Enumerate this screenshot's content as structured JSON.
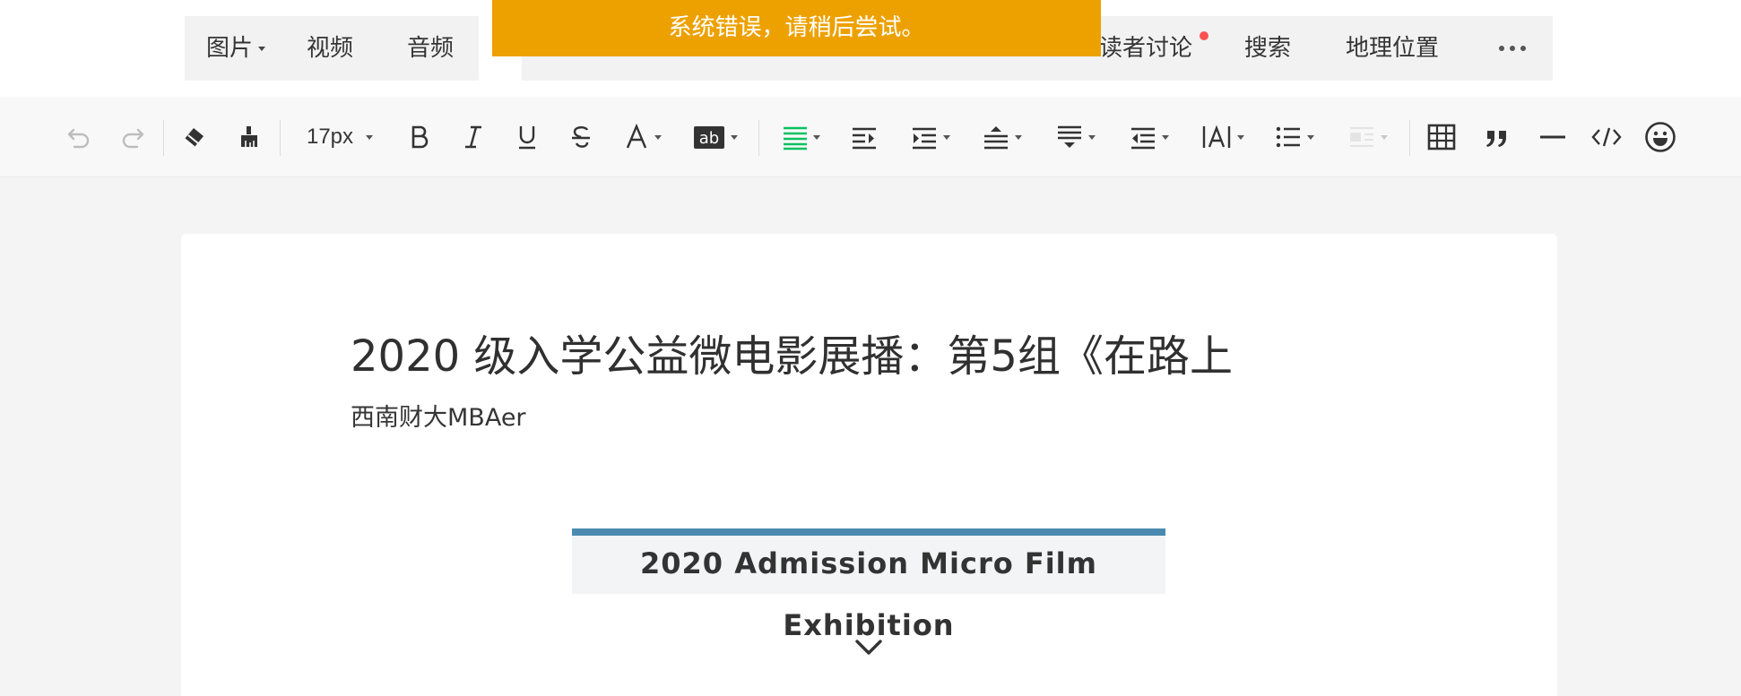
{
  "toast": {
    "message": "系统错误，请稍后尝试。"
  },
  "insert_bar": {
    "group_a": [
      {
        "label": "图片",
        "has_dropdown": true
      },
      {
        "label": "视频"
      },
      {
        "label": "音频"
      }
    ],
    "group_b_visible": [
      {
        "label": "读者讨论",
        "visible_text": "读者讨论",
        "has_red_dot": true
      },
      {
        "label": "搜索"
      },
      {
        "label": "地理位置"
      }
    ],
    "more_icon": "ellipsis-icon"
  },
  "toolbar": {
    "font_size": "17px",
    "accent_color": "#07c160",
    "icons": [
      "undo-icon",
      "redo-icon",
      "eraser-icon",
      "format-painter-icon",
      "bold-icon",
      "italic-icon",
      "underline-icon",
      "strikethrough-icon",
      "font-color-icon",
      "background-color-icon",
      "align-icon",
      "indent-icon",
      "first-line-indent-icon",
      "line-height-icon",
      "paragraph-spacing-icon",
      "outdent-icon",
      "letter-spacing-icon",
      "unordered-list-icon",
      "float-icon",
      "table-icon",
      "quote-icon",
      "horizontal-rule-icon",
      "code-icon",
      "emoji-icon"
    ]
  },
  "article": {
    "title": "2020 级入学公益微电影展播：第5组《在路上",
    "author": "西南财大MBAer",
    "banner_text": "2020 Admission Micro Film Exhibition",
    "banner_accent": "#4a8ab0"
  }
}
